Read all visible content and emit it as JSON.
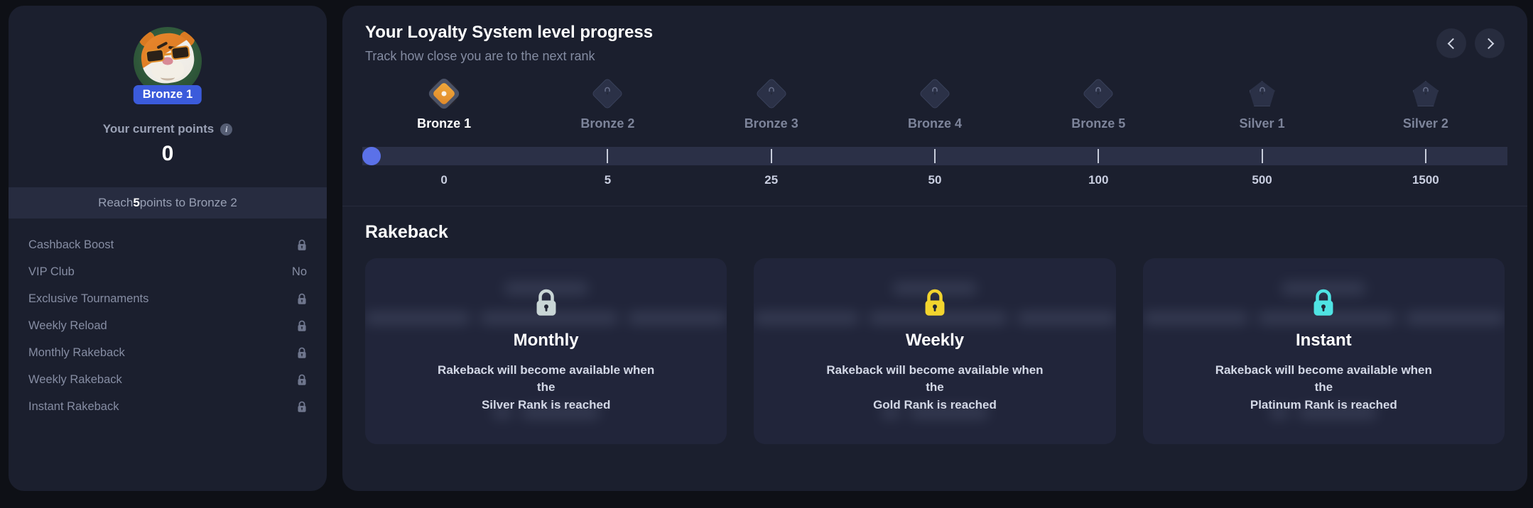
{
  "colors": {
    "page_bg": "#0e1016",
    "panel_bg": "#1b1f2e",
    "accent_blue": "#3b5bdb",
    "progress_fill": "#5b71e8",
    "active_rank_orange": "#e8892a",
    "lock_monthly": "#c9d6d6",
    "lock_weekly": "#f2d42e",
    "lock_instant": "#4fe3e3"
  },
  "sidebar": {
    "avatar_name": "tiger-avatar",
    "rank_pill": "Bronze 1",
    "points_label": "Your current points",
    "info_icon": "info-icon",
    "points_value": "0",
    "reach_prefix": "Reach ",
    "reach_amount": "5",
    "reach_suffix": " points to Bronze 2",
    "benefits": [
      {
        "label": "Cashback Boost",
        "value": "",
        "locked": true
      },
      {
        "label": "VIP Club",
        "value": "No",
        "locked": false
      },
      {
        "label": "Exclusive Tournaments",
        "value": "",
        "locked": true
      },
      {
        "label": "Weekly Reload",
        "value": "",
        "locked": true
      },
      {
        "label": "Monthly Rakeback",
        "value": "",
        "locked": true
      },
      {
        "label": "Weekly Rakeback",
        "value": "",
        "locked": true
      },
      {
        "label": "Instant Rakeback",
        "value": "",
        "locked": true
      }
    ]
  },
  "main": {
    "title": "Your Loyalty System level progress",
    "subtitle": "Track how close you are to the next rank",
    "prev_icon": "chevron-left-icon",
    "next_icon": "chevron-right-icon",
    "ranks": [
      {
        "label": "Bronze 1",
        "points": "0",
        "state": "active",
        "shape": "diamond"
      },
      {
        "label": "Bronze 2",
        "points": "5",
        "state": "locked",
        "shape": "diamond"
      },
      {
        "label": "Bronze 3",
        "points": "25",
        "state": "locked",
        "shape": "diamond"
      },
      {
        "label": "Bronze 4",
        "points": "50",
        "state": "locked",
        "shape": "diamond"
      },
      {
        "label": "Bronze 5",
        "points": "100",
        "state": "locked",
        "shape": "diamond"
      },
      {
        "label": "Silver 1",
        "points": "500",
        "state": "locked",
        "shape": "pentagon"
      },
      {
        "label": "Silver 2",
        "points": "1500",
        "state": "locked",
        "shape": "pentagon"
      }
    ],
    "progress_percent": 0,
    "rakeback_title": "Rakeback",
    "rakeback_cards": [
      {
        "title": "Monthly",
        "lock_icon": "lock-icon",
        "lock_color": "#c9d6d6",
        "desc_line1": "Rakeback will become available when the",
        "desc_line2": "Silver Rank is reached"
      },
      {
        "title": "Weekly",
        "lock_icon": "lock-icon",
        "lock_color": "#f2d42e",
        "desc_line1": "Rakeback will become available when the",
        "desc_line2": "Gold Rank is reached"
      },
      {
        "title": "Instant",
        "lock_icon": "lock-icon",
        "lock_color": "#4fe3e3",
        "desc_line1": "Rakeback will become available when the",
        "desc_line2": "Platinum Rank is reached"
      }
    ]
  }
}
